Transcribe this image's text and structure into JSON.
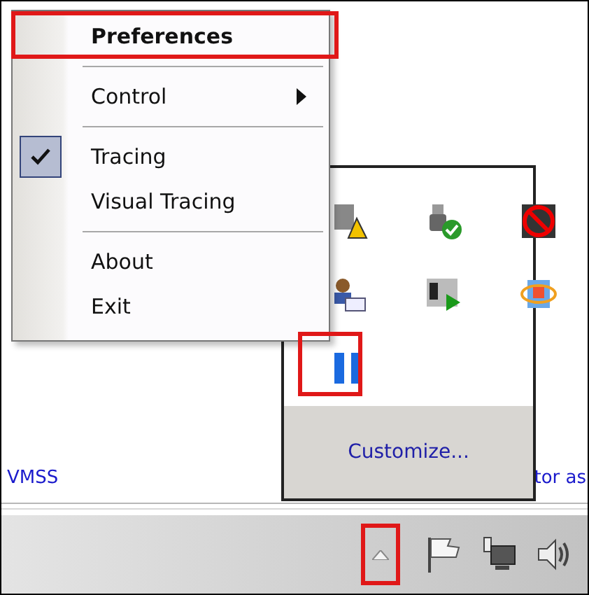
{
  "background_texts": [
    "VMSS",
    "tor as"
  ],
  "tray_popup": {
    "link": "Customize..."
  },
  "menu": {
    "items": [
      {
        "kind": "item",
        "label": "Preferences",
        "default": true,
        "checked": false
      },
      {
        "kind": "separator"
      },
      {
        "kind": "submenu",
        "label": "Control",
        "default": false,
        "checked": false
      },
      {
        "kind": "separator"
      },
      {
        "kind": "item",
        "label": "Tracing",
        "default": false,
        "checked": true
      },
      {
        "kind": "item",
        "label": "Visual Tracing",
        "default": false,
        "checked": false
      },
      {
        "kind": "separator"
      },
      {
        "kind": "item",
        "label": "About",
        "default": false,
        "checked": false
      },
      {
        "kind": "item",
        "label": "Exit",
        "default": false,
        "checked": false
      }
    ]
  }
}
